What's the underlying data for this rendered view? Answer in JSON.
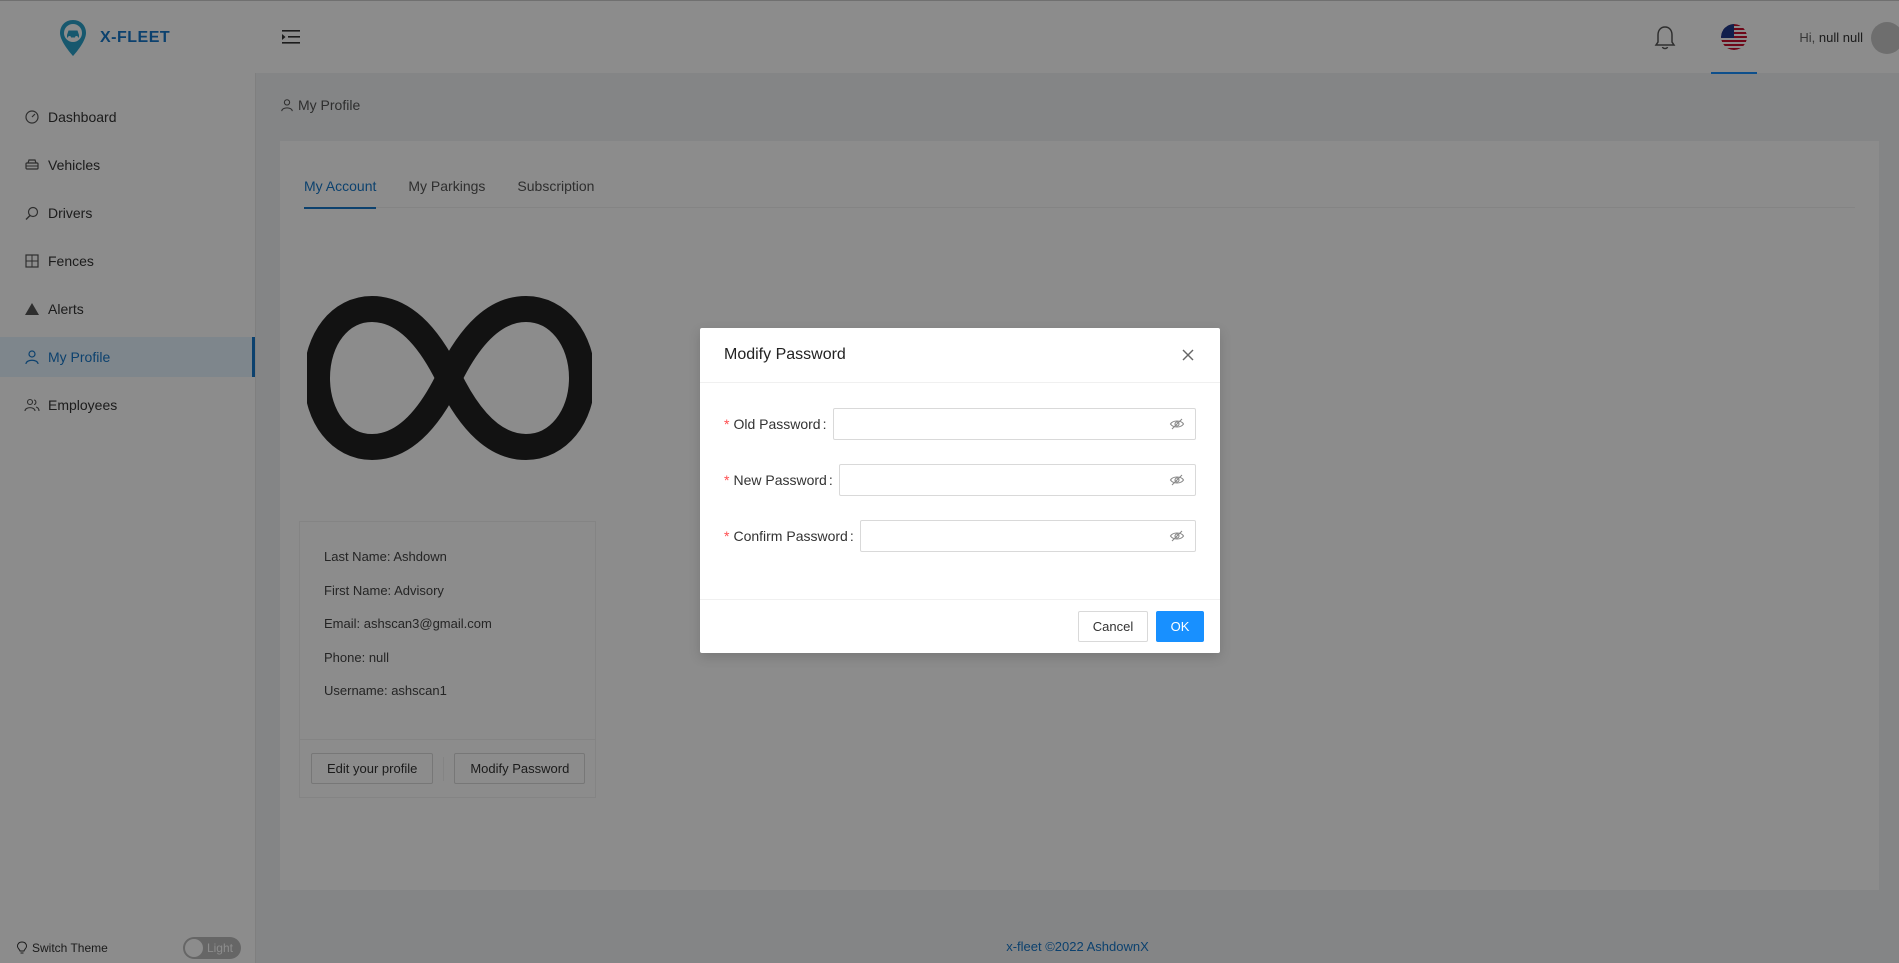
{
  "app": {
    "name": "X-FLEET"
  },
  "header": {
    "greeting_prefix": "Hi,",
    "user_name": "null null",
    "icons": [
      "menu-fold-icon",
      "bell-icon",
      "us-flag-icon",
      "avatar"
    ]
  },
  "sidebar": {
    "items": [
      {
        "label": "Dashboard",
        "icon": "dashboard-icon"
      },
      {
        "label": "Vehicles",
        "icon": "car-icon"
      },
      {
        "label": "Drivers",
        "icon": "search-icon"
      },
      {
        "label": "Fences",
        "icon": "border-icon"
      },
      {
        "label": "Alerts",
        "icon": "warning-icon"
      },
      {
        "label": "My Profile",
        "icon": "user-icon",
        "active": true
      },
      {
        "label": "Employees",
        "icon": "team-icon"
      }
    ],
    "switch_theme_label": "Switch Theme",
    "theme_toggle_label": "Light"
  },
  "breadcrumb": {
    "label": "My Profile"
  },
  "tabs": [
    {
      "label": "My Account",
      "active": true
    },
    {
      "label": "My Parkings"
    },
    {
      "label": "Subscription"
    }
  ],
  "profile": {
    "last_name": "Last Name: Ashdown",
    "first_name": "First Name: Advisory",
    "email": "Email: ashscan3@gmail.com",
    "phone": "Phone: null",
    "username": "Username: ashscan1",
    "edit_button": "Edit your profile",
    "modify_button": "Modify Password"
  },
  "footer": {
    "text": "x-fleet ©2022 AshdownX"
  },
  "modal": {
    "title": "Modify Password",
    "fields": [
      {
        "label": "Old Password",
        "value": "",
        "placeholder": ""
      },
      {
        "label": "New Password",
        "value": "",
        "placeholder": ""
      },
      {
        "label": "Confirm Password",
        "value": "",
        "placeholder": ""
      }
    ],
    "required_mark": "*",
    "colon": ":",
    "cancel_label": "Cancel",
    "ok_label": "OK"
  },
  "colors": {
    "primary": "#1890ff",
    "brand": "#1677c8",
    "required": "#ff4d4f",
    "mask": "rgba(0,0,0,0.45)"
  }
}
